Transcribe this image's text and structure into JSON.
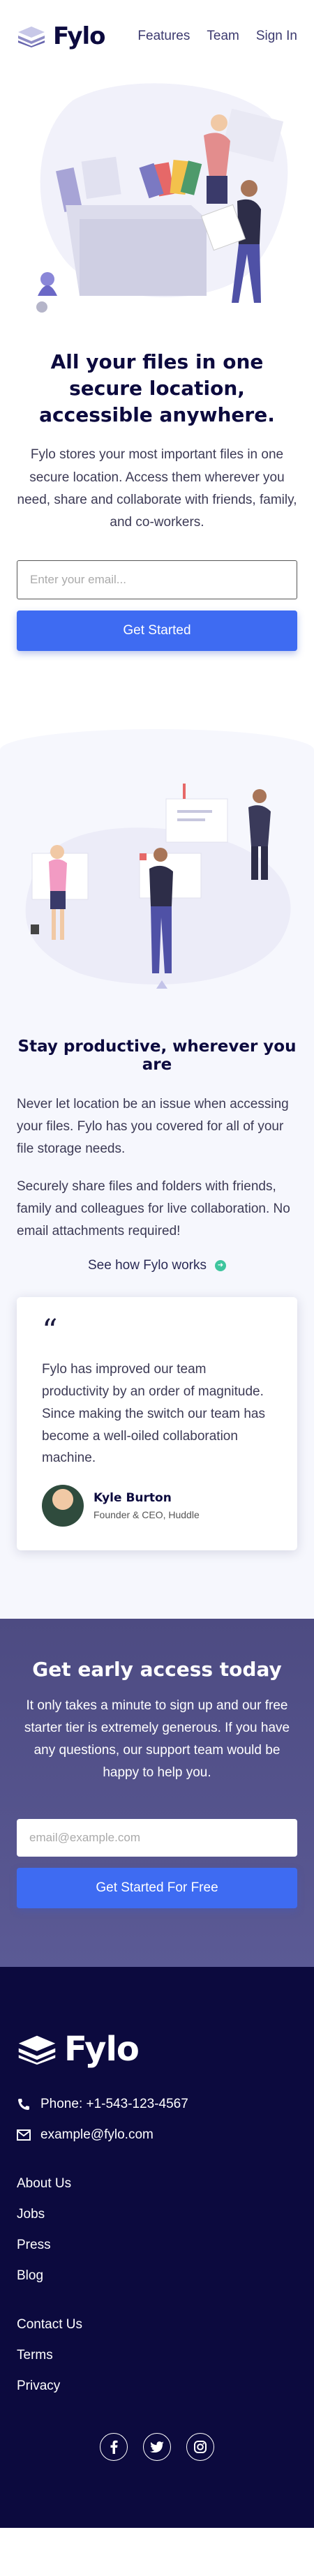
{
  "brand": {
    "name": "Fylo"
  },
  "nav": {
    "links": [
      "Features",
      "Team",
      "Sign In"
    ]
  },
  "hero": {
    "title": "All your files in one secure location, accessible anywhere.",
    "description": "Fylo stores your most important files in one secure location. Access them wherever you need, share and collaborate with friends, family, and co-workers.",
    "email_placeholder": "Enter your email...",
    "cta_label": "Get Started"
  },
  "productive": {
    "title": "Stay productive, wherever you are",
    "paragraph1": "Never let location be an issue when accessing your files. Fylo has you covered for all of your file storage needs.",
    "paragraph2": "Securely share files and folders with friends, family and colleagues for live collaboration. No email attachments required!",
    "link_label": "See how Fylo works"
  },
  "testimonial": {
    "quote": "Fylo has improved our team productivity by an order of magnitude. Since making the switch our team has become a well-oiled collaboration machine.",
    "name": "Kyle Burton",
    "role": "Founder & CEO, Huddle"
  },
  "access": {
    "title": "Get early access today",
    "description": "It only takes a minute to sign up and our free starter tier is extremely generous. If you have any questions, our support team would be happy to help you.",
    "email_placeholder": "email@example.com",
    "cta_label": "Get Started For Free"
  },
  "footer": {
    "phone": "Phone: +1-543-123-4567",
    "email": "example@fylo.com",
    "links_group1": [
      "About Us",
      "Jobs",
      "Press",
      "Blog"
    ],
    "links_group2": [
      "Contact Us",
      "Terms",
      "Privacy"
    ],
    "social_icons": [
      "facebook-icon",
      "twitter-icon",
      "instagram-icon"
    ]
  },
  "colors": {
    "navy": "#0c0a3e",
    "accent_blue": "#3e6bf2",
    "section_purple": "#4d4b82",
    "light_bg": "#f6f7fd",
    "green_arrow": "#3ec59e"
  }
}
